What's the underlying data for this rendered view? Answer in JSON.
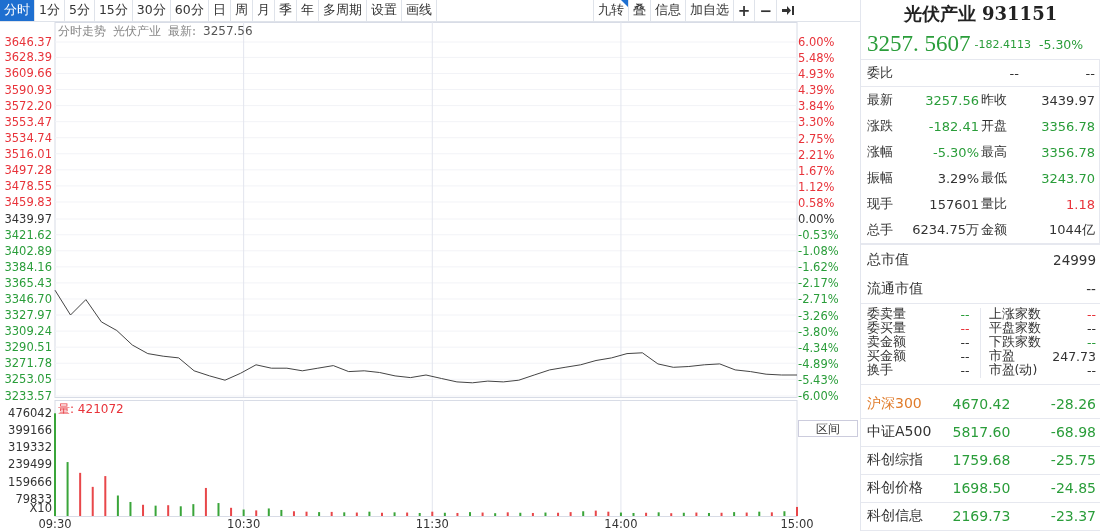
{
  "toolbar": {
    "periods": [
      {
        "label": "分时",
        "selected": true
      },
      {
        "label": "1分",
        "selected": false
      },
      {
        "label": "5分",
        "selected": false
      },
      {
        "label": "15分",
        "selected": false
      },
      {
        "label": "30分",
        "selected": false
      },
      {
        "label": "60分",
        "selected": false
      },
      {
        "label": "日",
        "selected": false
      },
      {
        "label": "周",
        "selected": false
      },
      {
        "label": "月",
        "selected": false
      },
      {
        "label": "季",
        "selected": false
      },
      {
        "label": "年",
        "selected": false
      },
      {
        "label": "多周期",
        "selected": false
      },
      {
        "label": "设置",
        "selected": false
      },
      {
        "label": "画线",
        "selected": false
      }
    ],
    "actions": [
      {
        "kind": "text",
        "label": "九转",
        "flagged": true
      },
      {
        "kind": "text",
        "label": "叠",
        "flagged": false
      },
      {
        "kind": "text",
        "label": "信息",
        "flagged": false
      },
      {
        "kind": "text",
        "label": "加自选",
        "flagged": false
      },
      {
        "kind": "symbol",
        "label": "+",
        "flagged": false
      },
      {
        "kind": "symbol",
        "label": "−",
        "flagged": false
      },
      {
        "kind": "collapse",
        "flagged": false
      }
    ]
  },
  "chart": {
    "title": "分时走势",
    "latest_label": "最新:",
    "latest_value": "3257.56",
    "chart_data": {
      "type": "line",
      "grid": true,
      "ylim": [
        3233.57,
        3646.37
      ],
      "yticks": [
        {
          "value": 3646.37,
          "label": "3646.37"
        },
        {
          "value": 3628.39,
          "label": "3628.39"
        },
        {
          "value": 3609.66,
          "label": "3609.66"
        },
        {
          "value": 3590.93,
          "label": "3590.93"
        },
        {
          "value": 3572.2,
          "label": "3572.20"
        },
        {
          "value": 3553.47,
          "label": "3553.47"
        },
        {
          "value": 3534.74,
          "label": "3534.74"
        },
        {
          "value": 3516.01,
          "label": "3516.01"
        },
        {
          "value": 3497.28,
          "label": "3497.28"
        },
        {
          "value": 3478.55,
          "label": "3478.55"
        },
        {
          "value": 3459.83,
          "label": "3459.83"
        },
        {
          "value": 3439.97,
          "label": "3439.97"
        },
        {
          "value": 3421.62,
          "label": "3421.62"
        },
        {
          "value": 3402.89,
          "label": "3402.89"
        },
        {
          "value": 3384.16,
          "label": "3384.16"
        },
        {
          "value": 3365.43,
          "label": "3365.43"
        },
        {
          "value": 3346.7,
          "label": "3346.70"
        },
        {
          "value": 3327.97,
          "label": "3327.97"
        },
        {
          "value": 3309.24,
          "label": "3309.24"
        },
        {
          "value": 3290.51,
          "label": "3290.51"
        },
        {
          "value": 3271.78,
          "label": "3271.78"
        },
        {
          "value": 3253.05,
          "label": "3253.05"
        },
        {
          "value": 3233.57,
          "label": "3233.57"
        }
      ],
      "series": [
        {
          "name": "光伏产业",
          "color": "#444444",
          "values": [
            3357,
            3328,
            3346,
            3320,
            3310,
            3293,
            3283,
            3280,
            3278,
            3263,
            3257,
            3252,
            3260,
            3270,
            3266,
            3266,
            3263,
            3266,
            3269,
            3262,
            3263,
            3261,
            3257,
            3255,
            3258,
            3254,
            3250,
            3249,
            3251,
            3250,
            3252,
            3258,
            3264,
            3267,
            3270,
            3275,
            3278,
            3283,
            3284,
            3271,
            3267,
            3268,
            3270,
            3271,
            3264,
            3262,
            3259,
            3258,
            3258
          ]
        }
      ]
    },
    "percent_labels": [
      "6.00%",
      "5.48%",
      "4.93%",
      "4.39%",
      "3.84%",
      "3.30%",
      "2.75%",
      "2.21%",
      "1.67%",
      "1.12%",
      "0.58%",
      "0.00%",
      "-0.53%",
      "-1.08%",
      "-1.62%",
      "-2.17%",
      "-2.71%",
      "-3.26%",
      "-3.80%",
      "-4.34%",
      "-4.89%",
      "-5.43%",
      "-6.00%"
    ]
  },
  "volume": {
    "label": "量: 421072",
    "unit": "X10",
    "range_button": "区间",
    "chart_data": {
      "type": "bar",
      "grid": true,
      "ylim": [
        0,
        482000
      ],
      "yticks": [
        476042,
        399166,
        319332,
        239499,
        159666,
        79833
      ],
      "categories": [
        "09:30",
        null,
        null,
        null,
        null,
        null,
        null,
        null,
        null,
        null,
        null,
        null,
        null,
        null,
        null,
        "10:30",
        null,
        null,
        null,
        null,
        null,
        null,
        null,
        null,
        null,
        null,
        null,
        null,
        null,
        null,
        "11:30",
        null,
        null,
        null,
        null,
        null,
        null,
        null,
        null,
        null,
        null,
        null,
        null,
        null,
        null,
        "14:00",
        null,
        null,
        null,
        null,
        null,
        null,
        null,
        null,
        null,
        null,
        null,
        null,
        null,
        "15:00"
      ],
      "series": [
        {
          "color": "#e8474a",
          "values": [
            null,
            null,
            200000,
            135000,
            185000,
            null,
            null,
            52000,
            null,
            50000,
            null,
            null,
            130000,
            null,
            38000,
            null,
            26000,
            null,
            null,
            22000,
            20000,
            null,
            19000,
            null,
            16000,
            null,
            15000,
            null,
            16000,
            null,
            20000,
            null,
            14000,
            null,
            16000,
            null,
            17000,
            null,
            14000,
            null,
            15000,
            18000,
            null,
            25000,
            20000,
            null,
            null,
            15000,
            null,
            13000,
            null,
            16000,
            null,
            15000,
            null,
            16000,
            null,
            17000,
            null,
            42000
          ]
        },
        {
          "color": "#3aa53a",
          "values": [
            476000,
            250000,
            null,
            null,
            null,
            95000,
            65000,
            null,
            48000,
            null,
            45000,
            55000,
            null,
            60000,
            null,
            30000,
            null,
            35000,
            28000,
            null,
            null,
            18000,
            null,
            17000,
            null,
            20000,
            null,
            17000,
            null,
            14000,
            null,
            15000,
            null,
            18000,
            null,
            13000,
            null,
            15000,
            null,
            16000,
            null,
            null,
            22000,
            null,
            null,
            16000,
            14000,
            null,
            17000,
            null,
            15000,
            null,
            14000,
            null,
            18000,
            null,
            20000,
            null,
            22000,
            null
          ]
        }
      ]
    }
  },
  "quote": {
    "title": "光伏产业 931151",
    "price": "3257. 5607",
    "change": "-182.4113",
    "percent": "-5.30%",
    "color": "#2a9d3a"
  },
  "bid_ratio": {
    "label": "委比",
    "value_1": "--",
    "value_2": "--"
  },
  "stats": [
    {
      "label": "最新",
      "value": "3257.56",
      "color": "#2a9d3a"
    },
    {
      "label": "昨收",
      "value": "3439.97",
      "color": "#333333"
    },
    {
      "label": "涨跌",
      "value": "-182.41",
      "color": "#2a9d3a"
    },
    {
      "label": "开盘",
      "value": "3356.78",
      "color": "#2a9d3a"
    },
    {
      "label": "涨幅",
      "value": "-5.30%",
      "color": "#2a9d3a"
    },
    {
      "label": "最高",
      "value": "3356.78",
      "color": "#2a9d3a"
    },
    {
      "label": "振幅",
      "value": "3.29%",
      "color": "#333333"
    },
    {
      "label": "最低",
      "value": "3243.70",
      "color": "#2a9d3a"
    },
    {
      "label": "现手",
      "value": "157601",
      "color": "#333333"
    },
    {
      "label": "量比",
      "value": "1.18",
      "color": "#e8333a"
    },
    {
      "label": "总手",
      "value": "6234.75万",
      "color": "#333333"
    },
    {
      "label": "金额",
      "value": "1044亿",
      "color": "#333333"
    }
  ],
  "market_cap": [
    {
      "label": "总市值",
      "value": "24999"
    },
    {
      "label": "流通市值",
      "value": "--"
    }
  ],
  "depth": [
    {
      "label": "委卖量",
      "value": "--",
      "color": "#2a9d3a"
    },
    {
      "label": "上涨家数",
      "value": "--",
      "color": "#e8333a"
    },
    {
      "label": "委买量",
      "value": "--",
      "color": "#e8333a"
    },
    {
      "label": "平盘家数",
      "value": "--",
      "color": "#333333"
    },
    {
      "label": "卖金额",
      "value": "--",
      "color": "#333333"
    },
    {
      "label": "下跌家数",
      "value": "--",
      "color": "#2a9d3a"
    },
    {
      "label": "买金额",
      "value": "--",
      "color": "#333333"
    },
    {
      "label": "市盈",
      "value": "247.73",
      "color": "#333333"
    },
    {
      "label": "换手",
      "value": "--",
      "color": "#333333"
    },
    {
      "label": "市盈(动)",
      "value": "--",
      "color": "#333333"
    }
  ],
  "indices": [
    {
      "name": "沪深300",
      "value": "4670.42",
      "change": "-28.26",
      "selected": true
    },
    {
      "name": "中证A500",
      "value": "5817.60",
      "change": "-68.98",
      "selected": false
    },
    {
      "name": "科创综指",
      "value": "1759.68",
      "change": "-25.75",
      "selected": false
    },
    {
      "name": "科创价格",
      "value": "1698.50",
      "change": "-24.85",
      "selected": false
    },
    {
      "name": "科创信息",
      "value": "2169.73",
      "change": "-23.37",
      "selected": false
    }
  ]
}
